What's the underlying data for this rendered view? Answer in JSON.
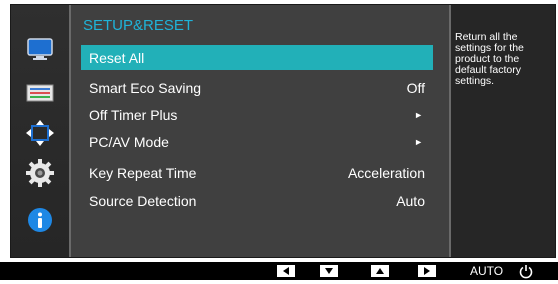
{
  "menu": {
    "title": "SETUP&RESET",
    "items": [
      {
        "label": "Reset All",
        "value": "",
        "arrow": false,
        "selected": true
      },
      {
        "label": "Smart Eco Saving",
        "value": "Off",
        "arrow": false,
        "selected": false
      },
      {
        "label": "Off Timer Plus",
        "value": "",
        "arrow": true,
        "selected": false
      },
      {
        "label": "PC/AV Mode",
        "value": "",
        "arrow": true,
        "selected": false
      },
      {
        "label": "Key Repeat Time",
        "value": "Acceleration",
        "arrow": false,
        "selected": false
      },
      {
        "label": "Source Detection",
        "value": "Auto",
        "arrow": false,
        "selected": false
      }
    ],
    "arrow_glyph": "►"
  },
  "help_text": "Return all the settings for the product to the default factory settings.",
  "sidebar": {
    "icons": [
      "monitor-icon",
      "color-bars-icon",
      "resize-arrows-icon",
      "gear-icon",
      "info-icon"
    ]
  },
  "bottom_bar": {
    "auto_label": "AUTO",
    "buttons": [
      "arrow-left-icon",
      "arrow-down-icon",
      "arrow-up-icon",
      "arrow-right-icon"
    ]
  },
  "colors": {
    "accent_title": "#1fb3d8",
    "selected_bg": "#22b0b8",
    "info_blue": "#1e88e5"
  }
}
